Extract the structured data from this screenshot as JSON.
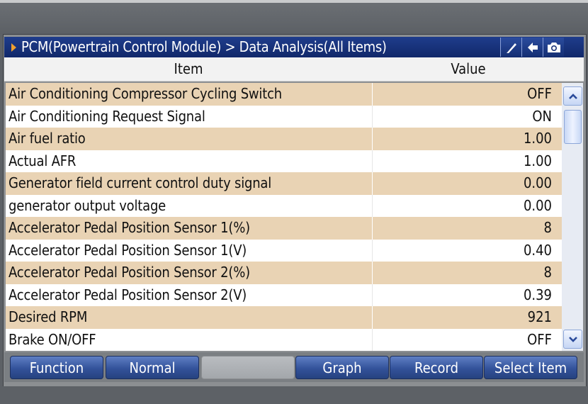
{
  "titlebar": {
    "title": "PCM(Powertrain Control Module) > Data Analysis(All Items)",
    "buttons": [
      "pen-icon",
      "back-arrow-icon",
      "camera-icon"
    ]
  },
  "table": {
    "headers": {
      "item": "Item",
      "value": "Value"
    },
    "rows": [
      {
        "name": "Air Conditioning Compressor Cycling Switch",
        "value": "OFF"
      },
      {
        "name": "Air Conditioning Request Signal",
        "value": "ON"
      },
      {
        "name": "Air fuel ratio",
        "value": "1.00"
      },
      {
        "name": "Actual AFR",
        "value": "1.00"
      },
      {
        "name": "Generator field current control duty signal",
        "value": "0.00"
      },
      {
        "name": "generator output voltage",
        "value": "0.00"
      },
      {
        "name": "Accelerator Pedal Position Sensor 1(%)",
        "value": "8"
      },
      {
        "name": "Accelerator Pedal Position Sensor 1(V)",
        "value": "0.40"
      },
      {
        "name": "Accelerator Pedal Position Sensor 2(%)",
        "value": "8"
      },
      {
        "name": "Accelerator Pedal Position Sensor 2(V)",
        "value": "0.39"
      },
      {
        "name": "Desired RPM",
        "value": "921"
      },
      {
        "name": "Brake ON/OFF",
        "value": "OFF"
      }
    ]
  },
  "footer": {
    "buttons": [
      "Function",
      "Normal",
      "",
      "Graph",
      "Record",
      "Select Item"
    ]
  },
  "colors": {
    "titlebar": "#11286a",
    "row_highlight": "#e9d3b4",
    "button": "#33529a"
  }
}
